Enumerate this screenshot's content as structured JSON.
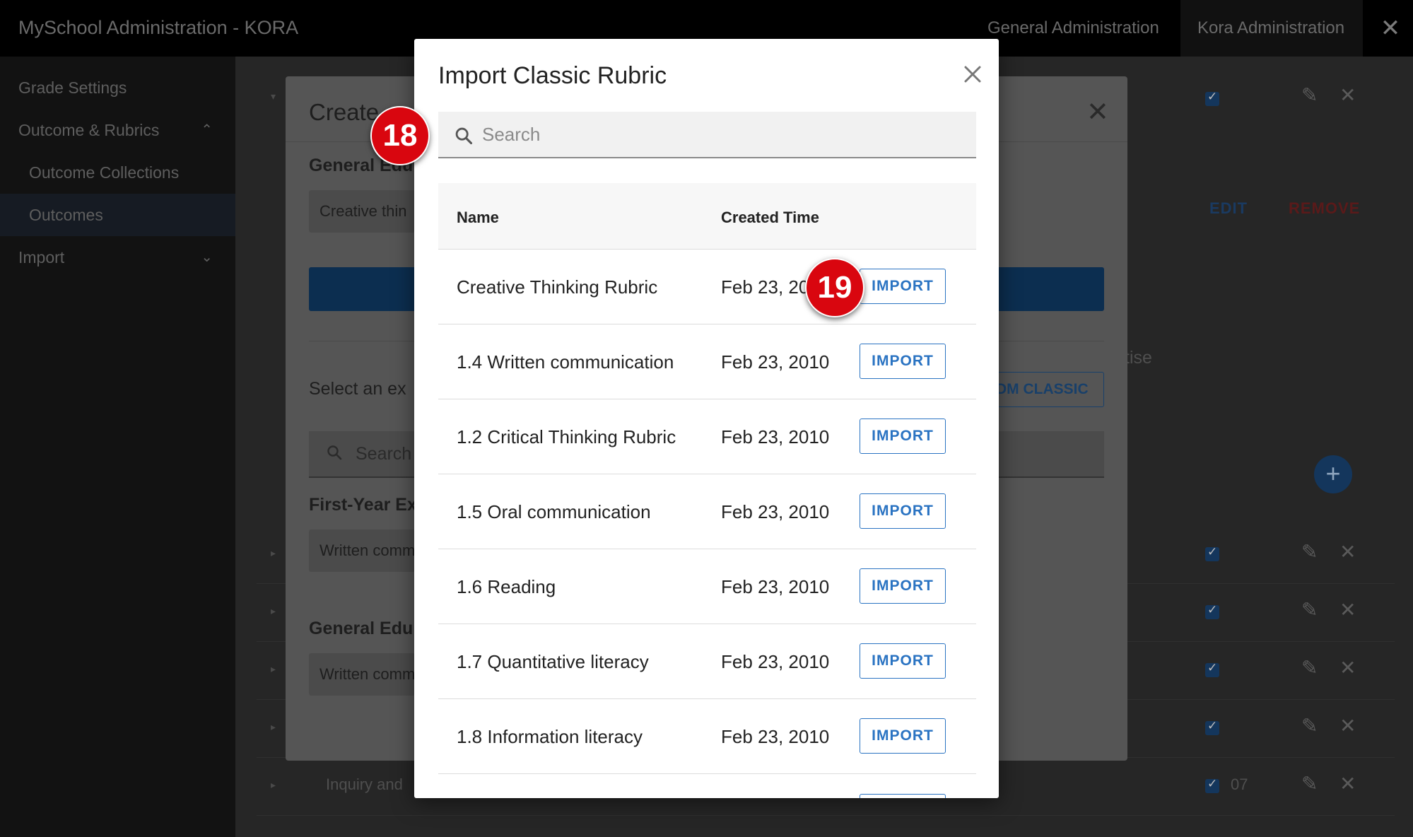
{
  "app": {
    "title": "MySchool Administration - KORA",
    "top_links": [
      "General Administration",
      "Kora Administration"
    ],
    "close_glyph": "✕"
  },
  "sidebar": {
    "items": [
      {
        "label": "Grade Settings"
      },
      {
        "label": "Outcome & Rubrics",
        "chevron": "⌃"
      },
      {
        "label": "Outcome Collections"
      },
      {
        "label": "Outcomes"
      },
      {
        "label": "Import",
        "chevron": "⌄"
      }
    ]
  },
  "background": {
    "edit_label": "EDIT",
    "remove_label": "REMOVE",
    "partial_text": "tise",
    "fab_glyph": "+",
    "row_text_inquiry": "Inquiry and",
    "row_text_07": "07"
  },
  "create_dialog": {
    "title": "Create",
    "close_glyph": "✕",
    "section1_label": "General Edu",
    "chip1": "Creative thin",
    "select_text": "Select an ex",
    "classic_button": "DM CLASSIC",
    "search_placeholder": "Search",
    "section2_label": "First-Year Ex",
    "chip2": "Written comm",
    "section3_label": "General Edu",
    "chip3": "Written comm"
  },
  "modal": {
    "title": "Import Classic Rubric",
    "search_placeholder": "Search",
    "columns": {
      "name": "Name",
      "created": "Created Time"
    },
    "import_label": "IMPORT",
    "rows": [
      {
        "name": "Creative Thinking Rubric",
        "created": "Feb 23, 20"
      },
      {
        "name": "1.4 Written communication",
        "created": "Feb 23, 2010"
      },
      {
        "name": "1.2 Critical Thinking Rubric",
        "created": "Feb 23, 2010"
      },
      {
        "name": "1.5 Oral communication",
        "created": "Feb 23, 2010"
      },
      {
        "name": "1.6 Reading",
        "created": "Feb 23, 2010"
      },
      {
        "name": "1.7 Quantitative literacy",
        "created": "Feb 23, 2010"
      },
      {
        "name": "1.8 Information literacy",
        "created": "Feb 23, 2010"
      }
    ]
  },
  "markers": [
    "18",
    "19"
  ],
  "colors": {
    "accent": "#2a73c2",
    "marker": "#d9060f",
    "topbar": "#000000"
  }
}
